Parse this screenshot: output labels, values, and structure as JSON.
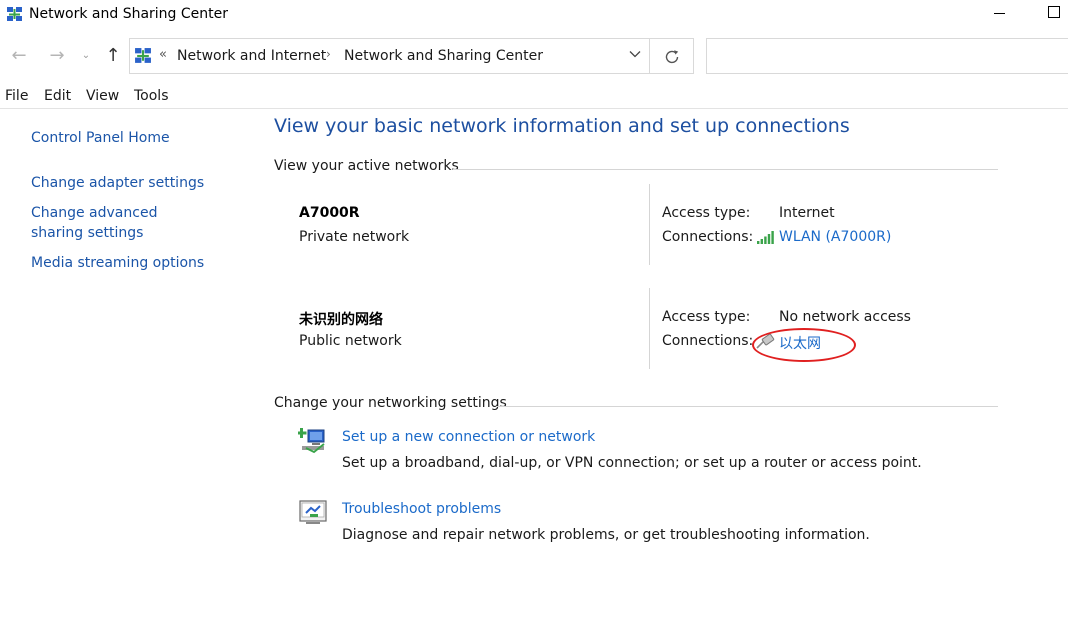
{
  "window": {
    "title": "Network and Sharing Center",
    "icon": "network-center-icon"
  },
  "address_bar": {
    "overflow": "«",
    "crumbs": [
      "Network and Internet",
      "Network and Sharing Center"
    ],
    "separator": "›"
  },
  "search": {
    "placeholder": ""
  },
  "menu": [
    {
      "label": "File"
    },
    {
      "label": "Edit"
    },
    {
      "label": "View"
    },
    {
      "label": "Tools"
    }
  ],
  "sidebar": {
    "items": [
      {
        "label": "Control Panel Home"
      },
      {
        "label": "Change adapter settings"
      },
      {
        "label": "Change advanced sharing settings"
      },
      {
        "label": "Media streaming options"
      }
    ]
  },
  "main": {
    "title": "View your basic network information and set up connections",
    "active_networks_header": "View your active networks",
    "access_type_label": "Access type:",
    "connections_label": "Connections:",
    "networks": [
      {
        "name": "A7000R",
        "type": "Private network",
        "access_type": "Internet",
        "connection": "WLAN (A7000R)",
        "connection_icon": "wifi-signal-icon"
      },
      {
        "name": "未识别的网络",
        "type": "Public network",
        "access_type": "No network access",
        "connection": "以太网",
        "connection_icon": "ethernet-cable-icon"
      }
    ],
    "settings_header": "Change your networking settings",
    "tasks": [
      {
        "link": "Set up a new connection or network",
        "desc": "Set up a broadband, dial-up, or VPN connection; or set up a router or access point.",
        "icon": "new-connection-icon"
      },
      {
        "link": "Troubleshoot problems",
        "desc": "Diagnose and repair network problems, or get troubleshooting information.",
        "icon": "troubleshoot-icon"
      }
    ]
  },
  "colors": {
    "link": "#1b6ac9",
    "title": "#1d4fa0",
    "highlight": "#e02020"
  }
}
